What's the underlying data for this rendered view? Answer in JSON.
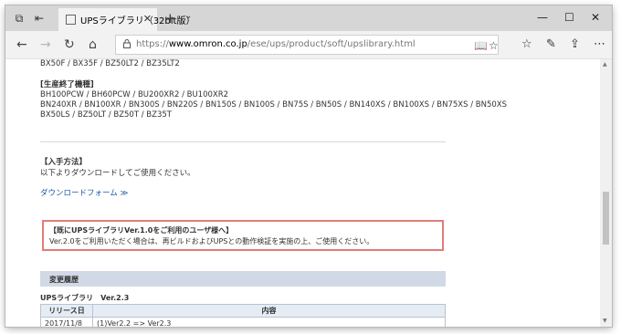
{
  "tab": {
    "title": "UPSライブラリ（32bit版）"
  },
  "address": {
    "url_prefix": "https://",
    "url_domain": "www.omron.co.jp",
    "url_path": "/ese/ups/product/soft/upslibrary.html"
  },
  "content": {
    "models_line_top": "BX50F / BX35F / BZ50LT2 / BZ35LT2",
    "discontinued_heading": "[生産終了機種]",
    "discontinued_lines": [
      "BH100PCW / BH60PCW / BU200XR2 / BU100XR2",
      "BN240XR / BN100XR / BN300S / BN220S / BN150S / BN100S / BN75S / BN50S / BN140XS / BN100XS / BN75XS / BN50XS",
      "BX50LS / BZ50LT / BZ50T / BZ35T"
    ],
    "obtain_heading": "【入手方法】",
    "obtain_text": "以下よりダウンロードしてご使用ください。",
    "download_link": "ダウンロードフォーム ≫",
    "notice_title": "【既にUPSライブラリVer.1.0をご利用のユーザ様へ】",
    "notice_text": "Ver.2.0をご利用いただく場合は、再ビルドおよびUPSとの動作検証を実施の上、ご使用ください。",
    "history_heading": "変更履歴",
    "version_title": "UPSライブラリ　Ver.2.3",
    "table_headers": [
      "リリース日",
      "内容"
    ],
    "table_row": [
      "2017/11/8",
      "(1)Ver2.2 => Ver2.3"
    ]
  }
}
